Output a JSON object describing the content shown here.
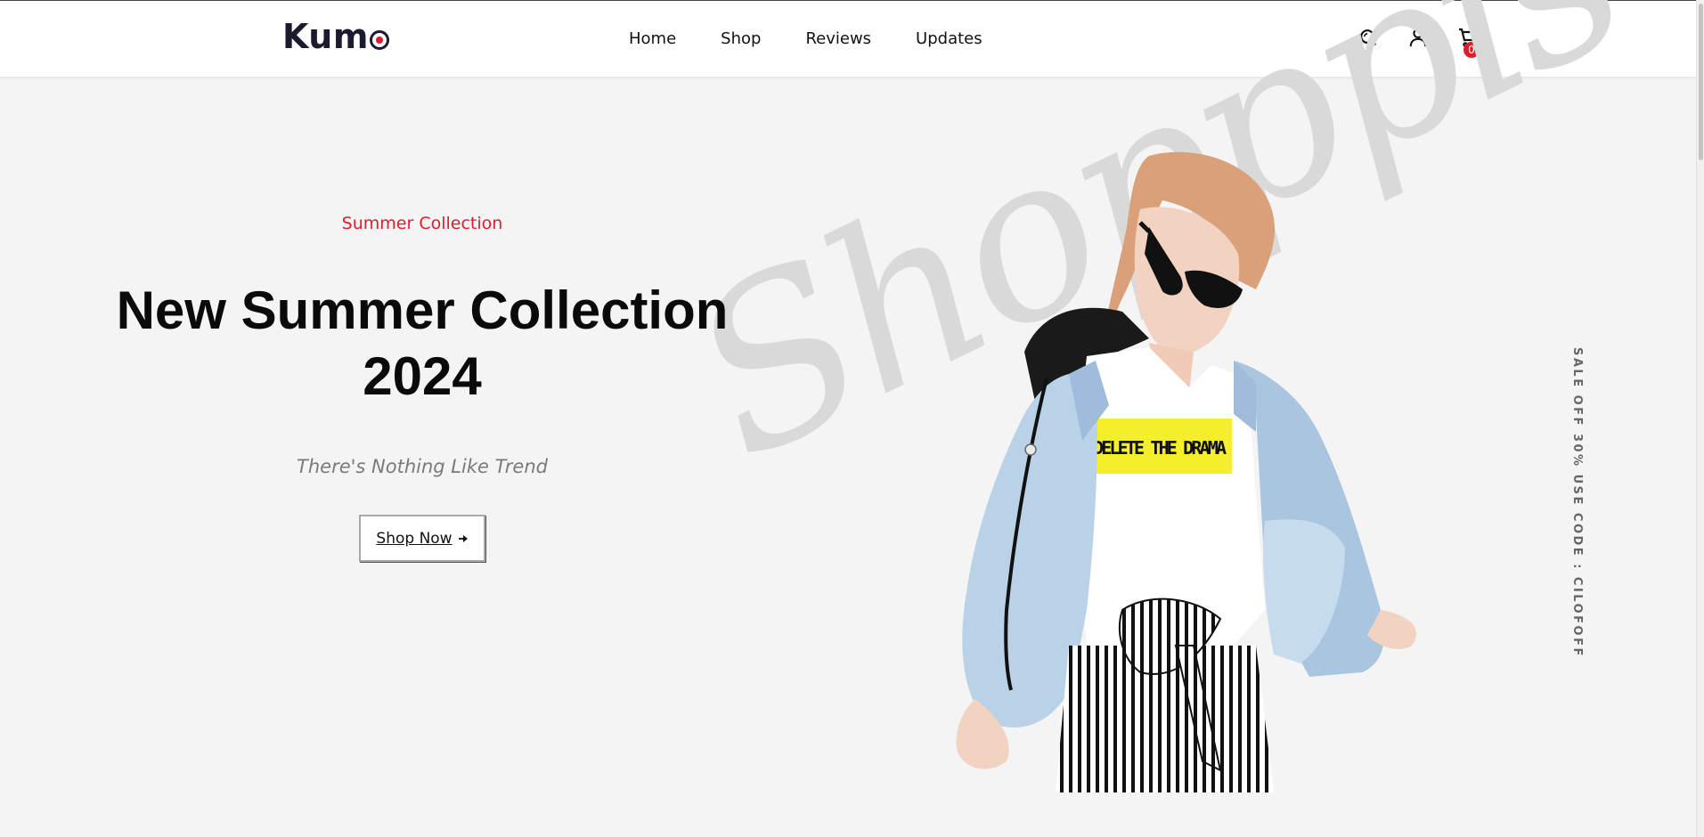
{
  "header": {
    "logo_text": "Kum",
    "nav": [
      "Home",
      "Shop",
      "Reviews",
      "Updates"
    ],
    "icons": [
      "search-icon",
      "user-icon",
      "cart-icon"
    ],
    "cart_count": "0"
  },
  "hero": {
    "kicker": "Summer Collection",
    "headline_line1": "New Summer Collection",
    "headline_line2": "2024",
    "tagline": "There's Nothing Like Trend",
    "cta_label": "Shop Now",
    "cta_icon": "arrow-right-icon",
    "watermark": "Shopppis",
    "side_promo": "SALE OFF 30% USE CODE : CILOFOFF",
    "shirt_text": "DELETE THE DRAMA"
  },
  "colors": {
    "accent": "#e21b2c",
    "background": "#f4f4f4",
    "denim": "#b9d2e8",
    "shirt_band": "#f4ef2a"
  }
}
